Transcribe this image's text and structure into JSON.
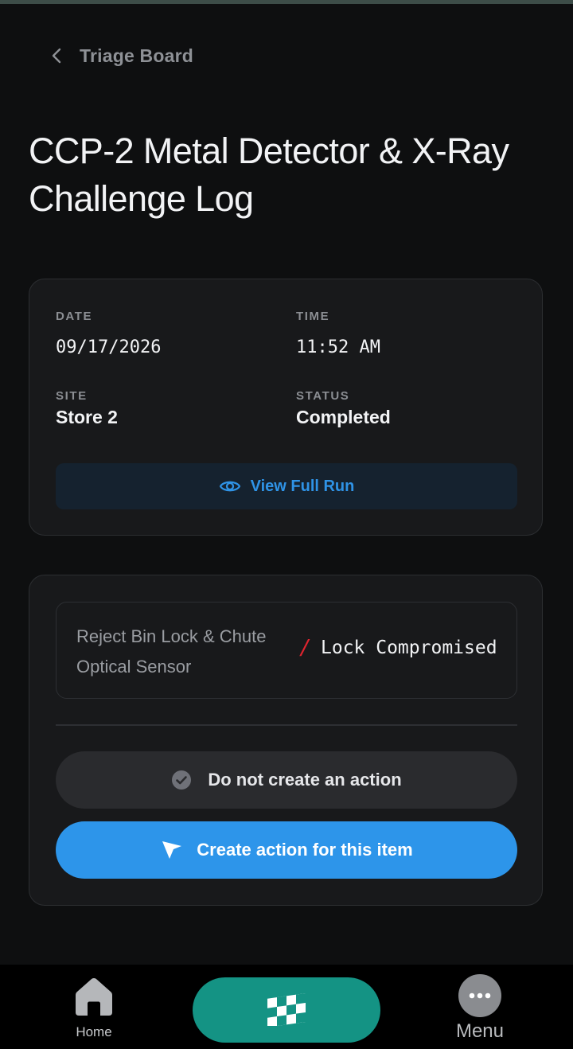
{
  "back": {
    "label": "Triage Board"
  },
  "title": "CCP-2 Metal Detector & X-Ray Challenge Log",
  "info": {
    "date_label": "DATE",
    "date_value": "09/17/2026",
    "time_label": "TIME",
    "time_value": "11:52 AM",
    "site_label": "SITE",
    "site_value": "Store 2",
    "status_label": "STATUS",
    "status_value": "Completed",
    "view_button": "View Full Run"
  },
  "item": {
    "description": "Reject Bin Lock & Chute Optical Sensor",
    "result_mark": "/",
    "result": "Lock Compromised",
    "no_action_button": "Do not create an action",
    "create_action_button": "Create action for this item"
  },
  "nav": {
    "home_label": "Home",
    "menu_label": "Menu"
  },
  "colors": {
    "accent_blue": "#2d95ea",
    "link_blue": "#2f93e6",
    "nav_teal": "#149384",
    "fail_red": "#e0242f"
  },
  "icons": {
    "back": "chevron-left-icon",
    "view": "eye-icon",
    "no_action": "check-circle-icon",
    "create_action": "cursor-arrow-icon",
    "home": "home-icon",
    "center": "checkered-flag-icon",
    "menu": "more-dots-icon"
  }
}
